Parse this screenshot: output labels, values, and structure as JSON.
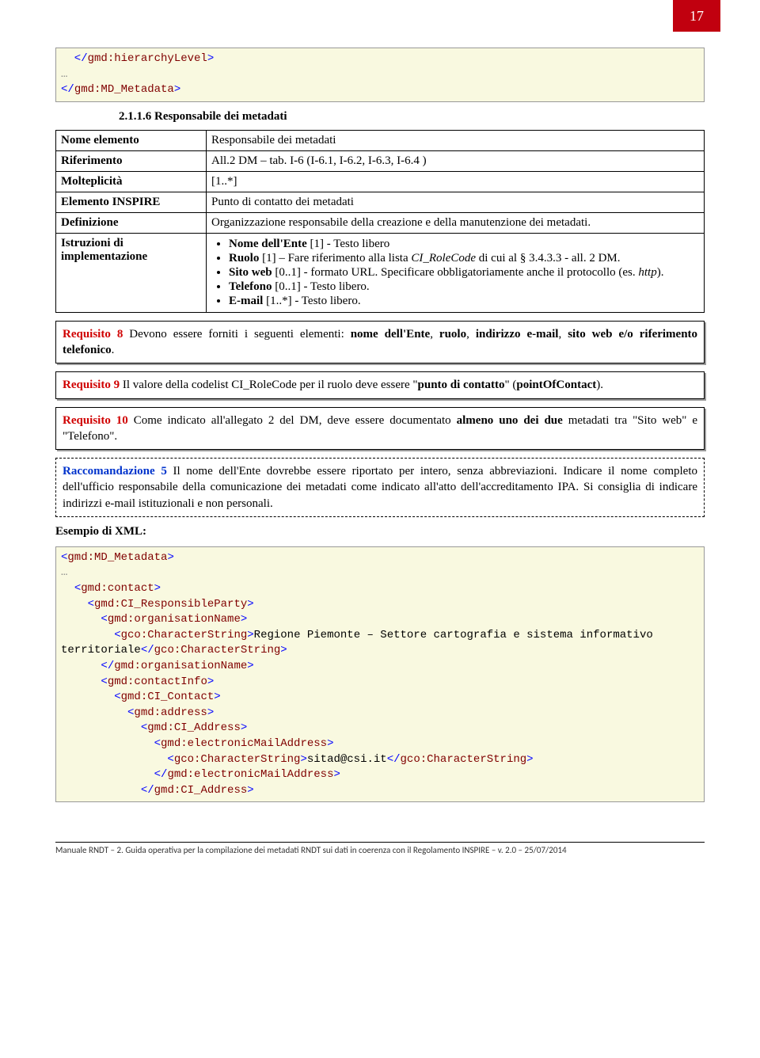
{
  "page_number": "17",
  "xml1": {
    "l1": "  </gmd:hierarchyLevel>",
    "l2": "…",
    "l3": "</gmd:MD_Metadata>"
  },
  "heading": "2.1.1.6    Responsabile dei metadati",
  "table": {
    "r1k": "Nome elemento",
    "r1v": "Responsabile dei metadati",
    "r2k": "Riferimento",
    "r2v": "All.2 DM – tab. I-6 (I-6.1, I-6.2, I-6.3, I-6.4 )",
    "r3k": "Molteplicità",
    "r3v": "[1..*]",
    "r4k": "Elemento INSPIRE",
    "r4v": "Punto di contatto dei metadati",
    "r5k": "Definizione",
    "r5v": "Organizzazione responsabile della creazione e della manutenzione dei metadati.",
    "r6k": "Istruzioni di implementazione",
    "r6_li1a": "Nome dell'Ente",
    "r6_li1b": " [1] - Testo libero",
    "r6_li2a": "Ruolo",
    "r6_li2b": " [1] – Fare riferimento alla lista ",
    "r6_li2c": "CI_RoleCode",
    "r6_li2d": " di cui al § 3.4.3.3 - all. 2 DM.",
    "r6_li3a": "Sito web",
    "r6_li3b": " [0..1] - formato URL. Specificare obbligatoriamente anche il protocollo (es. ",
    "r6_li3c": "http",
    "r6_li3d": ").",
    "r6_li4a": "Telefono",
    "r6_li4b": " [0..1] - Testo libero.",
    "r6_li5a": "E-mail",
    "r6_li5b": " [1..*] - Testo libero."
  },
  "req8": {
    "label": "Requisito 8",
    "t1": "  Devono essere forniti i seguenti elementi: ",
    "b1": "nome dell'Ente",
    "t2": ", ",
    "b2": "ruolo",
    "t3": ", ",
    "b3": "indirizzo e-mail",
    "t4": ", ",
    "b4": "sito web e/o riferimento telefonico",
    "t5": "."
  },
  "req9": {
    "label": "Requisito 9",
    "t1": "  Il valore della codelist CI_RoleCode per il ruolo deve essere \"",
    "b1": "punto di contatto",
    "t2": "\" (",
    "b2": "pointOfContact",
    "t3": ")."
  },
  "req10": {
    "label": "Requisito 10",
    "t1": " Come indicato all'allegato 2 del DM, deve essere documentato ",
    "b1": "almeno uno dei due",
    "t2": " metadati tra \"Sito web\" e \"Telefono\"."
  },
  "rec5": {
    "label": "Raccomandazione 5",
    "text": " Il nome dell'Ente dovrebbe essere riportato per intero, senza abbreviazioni. Indicare il nome completo dell'ufficio responsabile della comunicazione dei metadati come indicato all'atto dell'accreditamento IPA. Si consiglia di indicare indirizzi e-mail istituzionali e non personali."
  },
  "esempio": "Esempio di XML:",
  "xml2": {
    "l1": "<gmd:MD_Metadata>",
    "l2": "…",
    "l3": "  <gmd:contact>",
    "l4": "    <gmd:CI_ResponsibleParty>",
    "l5": "      <gmd:organisationName>",
    "l6a": "        <gco:CharacterString>",
    "l6b": "Regione Piemonte – Settore cartografia e sistema informativo territoriale",
    "l6c": "</gco:CharacterString>",
    "l7": "      </gmd:organisationName>",
    "l8": "      <gmd:contactInfo>",
    "l9": "        <gmd:CI_Contact>",
    "l10": "          <gmd:address>",
    "l11": "            <gmd:CI_Address>",
    "l12": "              <gmd:electronicMailAddress>",
    "l13a": "                <gco:CharacterString>",
    "l13b": "sitad@csi.it",
    "l13c": "</gco:CharacterString>",
    "l14": "              </gmd:electronicMailAddress>",
    "l15": "            </gmd:CI_Address>"
  },
  "footer": "Manuale RNDT – 2. Guida operativa per la compilazione dei metadati RNDT sui dati in coerenza con il Regolamento INSPIRE – v. 2.0 – 25/07/2014"
}
